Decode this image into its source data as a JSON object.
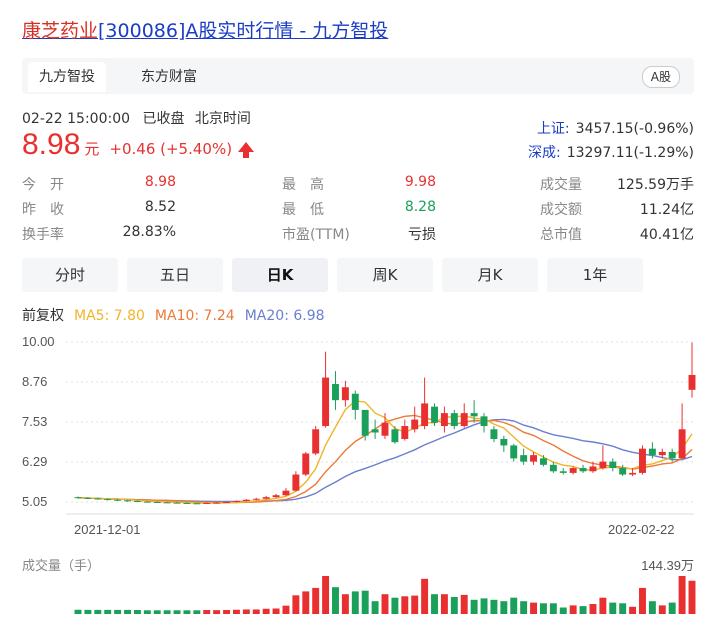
{
  "title": {
    "prefix": "康芝药业",
    "rest": "[300086]A股实时行情 - 九方智投"
  },
  "sources": {
    "tabs": [
      "九方智投",
      "东方财富"
    ],
    "badge": "A股"
  },
  "status": {
    "time": "02-22 15:00:00",
    "state": "已收盘",
    "zone": "北京时间"
  },
  "price": {
    "value": "8.98",
    "unit": "元",
    "change": "+0.46 (+5.40%)"
  },
  "indices": [
    {
      "label": "上证:",
      "value": "3457.15(-0.96%)"
    },
    {
      "label": "深成:",
      "value": "13297.11(-1.29%)"
    }
  ],
  "stats": [
    [
      {
        "label": "今　开",
        "value": "8.98",
        "cls": "red"
      },
      {
        "label": "最　高",
        "value": "9.98",
        "cls": "red"
      },
      {
        "label": "成交量",
        "value": "125.59万手",
        "cls": ""
      }
    ],
    [
      {
        "label": "昨　收",
        "value": "8.52",
        "cls": ""
      },
      {
        "label": "最　低",
        "value": "8.28",
        "cls": "green"
      },
      {
        "label": "成交额",
        "value": "11.24亿",
        "cls": ""
      }
    ],
    [
      {
        "label": "换手率",
        "value": "28.83%",
        "cls": ""
      },
      {
        "label": "市盈(TTM)",
        "value": "亏损",
        "cls": ""
      },
      {
        "label": "总市值",
        "value": "40.41亿",
        "cls": ""
      }
    ]
  ],
  "chart_tabs": [
    "分时",
    "五日",
    "日K",
    "周K",
    "月K",
    "1年"
  ],
  "active_chart_tab": "日K",
  "legend": {
    "adj": "前复权",
    "ma5": "MA5: 7.80",
    "ma10": "MA10: 7.24",
    "ma20": "MA20: 6.98"
  },
  "colors": {
    "up": "#e93030",
    "down": "#1aa05a",
    "ma5": "#f0b429",
    "ma10": "#ec7a3a",
    "ma20": "#6a7fd0",
    "link": "#1a3cc6"
  },
  "chart_data": {
    "type": "candlestick",
    "y_ticks": [
      "10.00",
      "8.76",
      "7.53",
      "6.29",
      "5.05"
    ],
    "ylim": [
      5.05,
      10.0
    ],
    "x_labels": {
      "start": "2021-12-01",
      "end": "2022-02-22"
    },
    "candles": [
      [
        5.2,
        5.18,
        5.22,
        5.15
      ],
      [
        5.18,
        5.16,
        5.2,
        5.14
      ],
      [
        5.16,
        5.14,
        5.18,
        5.12
      ],
      [
        5.14,
        5.12,
        5.16,
        5.1
      ],
      [
        5.12,
        5.1,
        5.14,
        5.08
      ],
      [
        5.1,
        5.08,
        5.12,
        5.06
      ],
      [
        5.08,
        5.06,
        5.1,
        5.05
      ],
      [
        5.06,
        5.05,
        5.08,
        5.04
      ],
      [
        5.05,
        5.04,
        5.07,
        5.03
      ],
      [
        5.04,
        5.03,
        5.06,
        5.02
      ],
      [
        5.03,
        5.02,
        5.05,
        5.01
      ],
      [
        5.02,
        5.01,
        5.04,
        5.0
      ],
      [
        5.01,
        5.0,
        5.03,
        4.99
      ],
      [
        5.0,
        5.02,
        5.04,
        4.99
      ],
      [
        5.02,
        5.03,
        5.05,
        5.0
      ],
      [
        5.03,
        5.05,
        5.07,
        5.02
      ],
      [
        5.05,
        5.08,
        5.1,
        5.04
      ],
      [
        5.08,
        5.12,
        5.14,
        5.07
      ],
      [
        5.12,
        5.15,
        5.18,
        5.1
      ],
      [
        5.15,
        5.2,
        5.24,
        5.13
      ],
      [
        5.2,
        5.26,
        5.3,
        5.18
      ],
      [
        5.26,
        5.4,
        5.48,
        5.24
      ],
      [
        5.4,
        5.9,
        6.0,
        5.38
      ],
      [
        5.9,
        6.55,
        6.6,
        5.85
      ],
      [
        6.55,
        7.3,
        7.4,
        6.5
      ],
      [
        7.4,
        8.9,
        9.7,
        7.35
      ],
      [
        8.7,
        8.2,
        9.1,
        7.9
      ],
      [
        8.2,
        8.6,
        8.8,
        8.0
      ],
      [
        8.4,
        7.9,
        8.5,
        7.6
      ],
      [
        7.9,
        7.1,
        7.6,
        6.95
      ],
      [
        7.3,
        7.2,
        7.6,
        7.0
      ],
      [
        7.1,
        7.5,
        7.8,
        7.0
      ],
      [
        7.3,
        6.9,
        7.4,
        6.85
      ],
      [
        7.0,
        7.4,
        7.6,
        6.95
      ],
      [
        7.3,
        7.6,
        8.0,
        7.2
      ],
      [
        7.4,
        8.1,
        8.9,
        7.3
      ],
      [
        8.0,
        7.5,
        8.1,
        7.4
      ],
      [
        7.4,
        7.8,
        8.0,
        7.2
      ],
      [
        7.8,
        7.4,
        7.9,
        7.3
      ],
      [
        7.4,
        7.8,
        8.1,
        7.35
      ],
      [
        7.8,
        7.7,
        8.2,
        7.5
      ],
      [
        7.7,
        7.4,
        7.8,
        7.2
      ],
      [
        7.3,
        7.0,
        7.4,
        6.9
      ],
      [
        7.0,
        6.8,
        7.1,
        6.6
      ],
      [
        6.8,
        6.4,
        6.85,
        6.3
      ],
      [
        6.5,
        6.3,
        6.7,
        6.2
      ],
      [
        6.3,
        6.5,
        6.6,
        6.2
      ],
      [
        6.4,
        6.2,
        6.5,
        6.15
      ],
      [
        6.2,
        6.0,
        6.3,
        5.95
      ],
      [
        6.0,
        5.95,
        6.1,
        5.9
      ],
      [
        5.95,
        6.1,
        6.15,
        5.9
      ],
      [
        6.1,
        6.0,
        6.2,
        5.95
      ],
      [
        6.0,
        6.15,
        6.3,
        5.95
      ],
      [
        6.1,
        6.3,
        6.8,
        6.05
      ],
      [
        6.3,
        6.1,
        6.4,
        6.0
      ],
      [
        6.1,
        5.9,
        6.2,
        5.85
      ],
      [
        5.9,
        5.95,
        6.1,
        5.85
      ],
      [
        5.95,
        6.7,
        6.8,
        5.9
      ],
      [
        6.7,
        6.5,
        6.9,
        6.4
      ],
      [
        6.5,
        6.6,
        6.7,
        6.4
      ],
      [
        6.6,
        6.4,
        6.7,
        6.3
      ],
      [
        6.4,
        7.3,
        8.1,
        6.4
      ],
      [
        8.52,
        8.98,
        9.98,
        8.28
      ]
    ]
  },
  "volume": {
    "label": "成交量（手）",
    "max": "144.39万"
  }
}
